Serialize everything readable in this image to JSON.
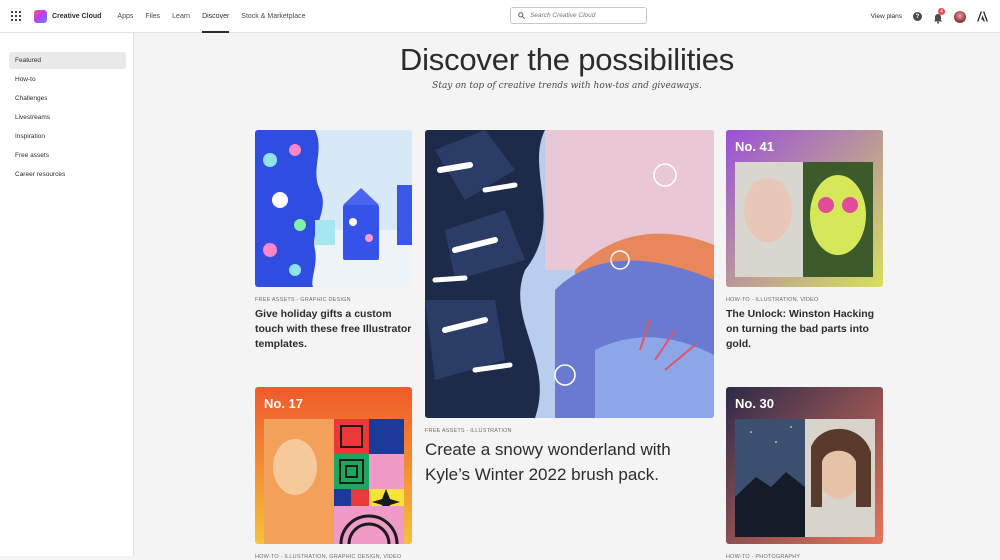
{
  "topbar": {
    "brand": "Creative Cloud",
    "nav": [
      "Apps",
      "Files",
      "Learn",
      "Discover",
      "Stock & Marketplace"
    ],
    "active_nav": "Discover",
    "search_placeholder": "Search Creative Cloud",
    "view_plans": "View plans",
    "help_label": "?",
    "notification_count": "4"
  },
  "sidebar": {
    "items": [
      "Featured",
      "How-to",
      "Challenges",
      "Livestreams",
      "Inspiration",
      "Free assets",
      "Career resources"
    ],
    "active": "Featured"
  },
  "hero": {
    "title": "Discover the possibilities",
    "subtitle": "Stay on top of creative trends with how-tos and giveaways."
  },
  "cards": [
    {
      "meta": "FREE ASSETS - GRAPHIC DESIGN",
      "title": "Give holiday gifts a custom touch with these free Illustrator templates.",
      "image": "holiday-gift-boxes-illustration"
    },
    {
      "meta": "FREE ASSETS - ILLUSTRATION",
      "title": "Create a snowy wonderland with Kyle’s Winter 2022 brush pack.",
      "image": "snowy-pine-illustration"
    },
    {
      "badge": "No. 41",
      "meta": "HOW-TO - ILLUSTRATION, VIDEO",
      "title": "The Unlock: Winston Hacking on turning the bad parts into gold.",
      "image": "winston-hacking-portrait"
    },
    {
      "badge": "No. 17",
      "meta": "HOW-TO - ILLUSTRATION, GRAPHIC DESIGN, VIDEO",
      "title": "",
      "image": "portrait-with-geometric-pattern"
    },
    {
      "badge": "No. 30",
      "meta": "HOW-TO - PHOTOGRAPHY",
      "title": "",
      "image": "night-sky-and-portrait"
    }
  ],
  "colors": {
    "accent": "#2c2c2c",
    "background": "#f4f4f4",
    "badge_red": "#e34850"
  }
}
